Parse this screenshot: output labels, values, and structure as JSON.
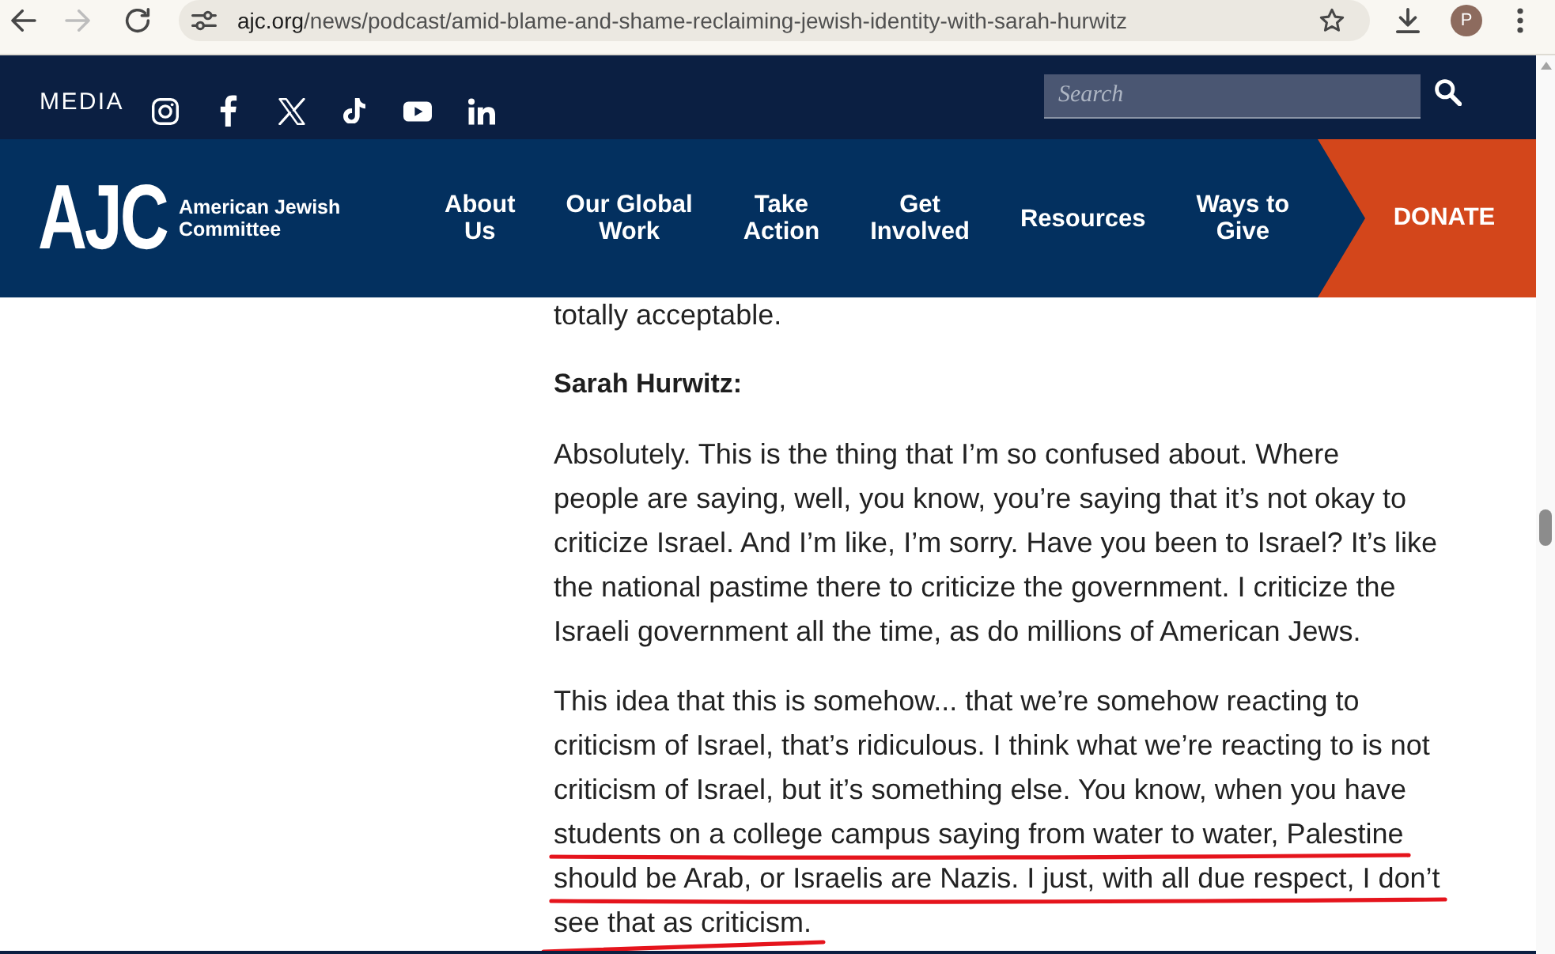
{
  "browser": {
    "forward_disabled": true,
    "url": {
      "host": "ajc.org",
      "path": "/news/podcast/amid-blame-and-shame-reclaiming-jewish-identity-with-sarah-hurwitz"
    },
    "profile_initial": "P"
  },
  "header": {
    "media_label": "MEDIA",
    "search": {
      "placeholder": "Search"
    }
  },
  "nav": {
    "logo": {
      "mark": "AJC",
      "name_lines": [
        "American Jewish",
        "Committee"
      ]
    },
    "items": [
      {
        "lines": [
          "About",
          "Us"
        ]
      },
      {
        "lines": [
          "Our Global",
          "Work"
        ]
      },
      {
        "lines": [
          "Take",
          "Action"
        ]
      },
      {
        "lines": [
          "Get",
          "Involved"
        ]
      },
      {
        "lines": [
          "Resources"
        ]
      },
      {
        "lines": [
          "Ways to",
          "Give"
        ]
      }
    ],
    "donate": "DONATE"
  },
  "article": {
    "blocks": [
      {
        "kind": "paragraph",
        "lines": [
          {
            "text": "totally acceptable."
          }
        ]
      },
      {
        "kind": "speaker",
        "text": "Sarah Hurwitz:"
      },
      {
        "kind": "paragraph",
        "lines": [
          {
            "text": "Absolutely. This is the thing that I’m so confused about. Where"
          },
          {
            "text": "people are saying, well, you know, you’re saying that it’s not okay to"
          },
          {
            "text": "criticize Israel. And I’m like, I’m sorry. Have you been to Israel? It’s like"
          },
          {
            "text": "the national pastime there to criticize the government. I criticize the"
          },
          {
            "text": "Israeli government all the time, as do millions of American Jews."
          }
        ]
      },
      {
        "kind": "paragraph",
        "lines": [
          {
            "text": "This idea that this is somehow... that we’re somehow reacting to",
            "underlined": false
          },
          {
            "text": "criticism of Israel, that’s ridiculous. I think what we’re reacting to is not",
            "underlined": false
          },
          {
            "text": "criticism of Israel, but it’s something else. You know, when you have",
            "underlined": false
          },
          {
            "text": "students on a college campus saying from water to water, Palestine",
            "underlined": true,
            "slanted": false
          },
          {
            "text": "should be Arab, or Israelis are Nazis. I just, with all due respect, I don’t",
            "underlined": true,
            "slanted": false
          },
          {
            "text": "see that as criticism.",
            "underlined": true,
            "slanted": true
          }
        ]
      }
    ]
  }
}
